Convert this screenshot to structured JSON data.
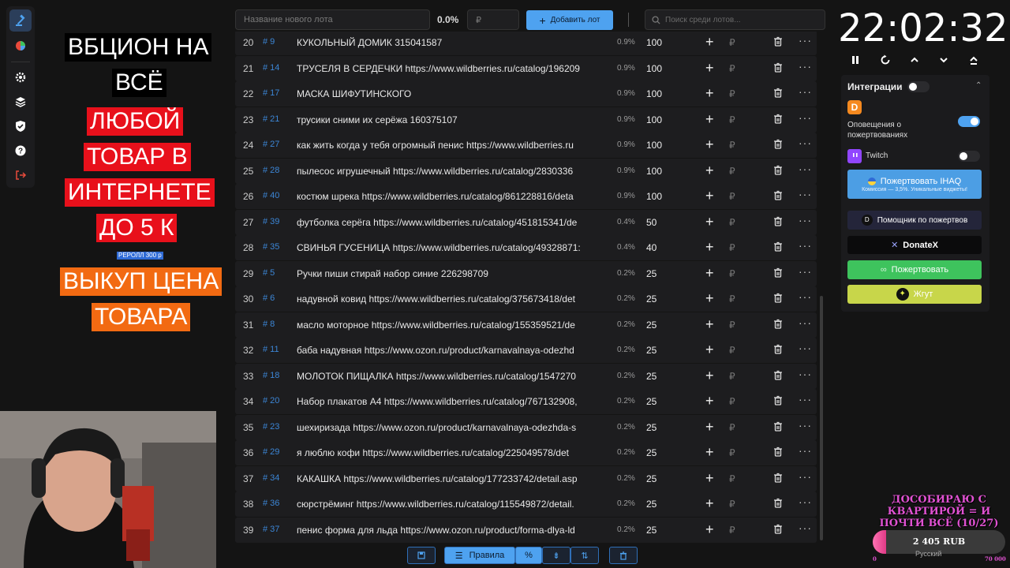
{
  "overlay": {
    "line1": "ВБЦИОН НА",
    "line2": "ВСЁ",
    "line3": "ЛЮБОЙ",
    "line4": "ТОВАР В",
    "line5": "ИНТЕРНЕТЕ",
    "line6": "ДО 5 К",
    "small": "РЕРОЛЛ 300 р",
    "line7": "ВЫКУП ЦЕНА",
    "line8": "ТОВАРА"
  },
  "topbar": {
    "new_lot_placeholder": "Название нового лота",
    "percent": "0.0%",
    "rub_placeholder": "₽",
    "add_label": "Добавить лот",
    "search_placeholder": "Поиск среди лотов..."
  },
  "lots": [
    {
      "num": "20",
      "tag": "# 9",
      "title": "КУКОЛЬНЫЙ ДОМИК 315041587",
      "pct": "0.9%",
      "amount": "100"
    },
    {
      "num": "21",
      "tag": "# 14",
      "title": "ТРУСЕЛЯ В СЕРДЕЧКИ https://www.wildberries.ru/catalog/196209",
      "pct": "0.9%",
      "amount": "100"
    },
    {
      "num": "22",
      "tag": "# 17",
      "title": "МАСКА ШИФУТИНСКОГО",
      "pct": "0.9%",
      "amount": "100"
    },
    {
      "num": "23",
      "tag": "# 21",
      "title": "трусики сними их серёжа 160375107",
      "pct": "0.9%",
      "amount": "100"
    },
    {
      "num": "24",
      "tag": "# 27",
      "title": "как жить когда у тебя огромный пенис https://www.wildberries.ru",
      "pct": "0.9%",
      "amount": "100"
    },
    {
      "num": "25",
      "tag": "# 28",
      "title": "пылесос игрушечный https://www.wildberries.ru/catalog/2830336",
      "pct": "0.9%",
      "amount": "100"
    },
    {
      "num": "26",
      "tag": "# 40",
      "title": "костюм шрека https://www.wildberries.ru/catalog/861228816/deta",
      "pct": "0.9%",
      "amount": "100"
    },
    {
      "num": "27",
      "tag": "# 39",
      "title": "футболка серёга https://www.wildberries.ru/catalog/451815341/de",
      "pct": "0.4%",
      "amount": "50"
    },
    {
      "num": "28",
      "tag": "# 35",
      "title": "СВИНЬЯ ГУСЕНИЦА https://www.wildberries.ru/catalog/49328871:",
      "pct": "0.4%",
      "amount": "40"
    },
    {
      "num": "29",
      "tag": "# 5",
      "title": "Ручки пиши стирай набор синие 226298709",
      "pct": "0.2%",
      "amount": "25"
    },
    {
      "num": "30",
      "tag": "# 6",
      "title": "надувной ковид https://www.wildberries.ru/catalog/375673418/det",
      "pct": "0.2%",
      "amount": "25"
    },
    {
      "num": "31",
      "tag": "# 8",
      "title": "масло моторное https://www.wildberries.ru/catalog/155359521/de",
      "pct": "0.2%",
      "amount": "25"
    },
    {
      "num": "32",
      "tag": "# 11",
      "title": "баба надувная https://www.ozon.ru/product/karnavalnaya-odezhd",
      "pct": "0.2%",
      "amount": "25"
    },
    {
      "num": "33",
      "tag": "# 18",
      "title": "МОЛОТОК ПИЩАЛКА https://www.wildberries.ru/catalog/1547270",
      "pct": "0.2%",
      "amount": "25"
    },
    {
      "num": "34",
      "tag": "# 20",
      "title": "Набор плакатов А4 https://www.wildberries.ru/catalog/767132908,",
      "pct": "0.2%",
      "amount": "25"
    },
    {
      "num": "35",
      "tag": "# 23",
      "title": "шехиризада https://www.ozon.ru/product/karnavalnaya-odezhda-s",
      "pct": "0.2%",
      "amount": "25"
    },
    {
      "num": "36",
      "tag": "# 29",
      "title": "я люблю кофи https://www.wildberries.ru/catalog/225049578/det",
      "pct": "0.2%",
      "amount": "25"
    },
    {
      "num": "37",
      "tag": "# 34",
      "title": "КАКАШКА https://www.wildberries.ru/catalog/177233742/detail.asp",
      "pct": "0.2%",
      "amount": "25"
    },
    {
      "num": "38",
      "tag": "# 36",
      "title": "сюрстрёминг https://www.wildberries.ru/catalog/115549872/detail.",
      "pct": "0.2%",
      "amount": "25"
    },
    {
      "num": "39",
      "tag": "# 37",
      "title": "пенис форма для льда https://www.ozon.ru/product/forma-dlya-ld",
      "pct": "0.2%",
      "amount": "25"
    }
  ],
  "bottombar": {
    "rules_label": "Правила"
  },
  "clock": {
    "time": "22:02:32"
  },
  "integrations": {
    "title": "Интеграции",
    "donation_alerts": "Оповещения о пожертвованиях",
    "twitch": "Twitch",
    "ihaq_label": "Пожертвовать IHAQ",
    "ihaq_sub": "Комиссия — 3,5%. Уникальные виджеты!",
    "helper_label": "Помощник по пожертвов",
    "donatex_label": "DonateX",
    "donate_label": "Пожертвовать",
    "zhgut_label": "Жгут"
  },
  "goal": {
    "text": "ДОСОБИРАЮ С КВАРТИРОЙ = И ПОЧТИ ВСЁ (10/27)",
    "value": "2 405 RUB",
    "min": "0",
    "max": "70 000",
    "progress_fraction": 0.1
  },
  "lang": "Русский",
  "colors": {
    "accent": "#4ea2f0",
    "red": "#e8101b",
    "orange": "#f26a12",
    "green": "#3ec35d",
    "yellow": "#c8d64a"
  }
}
